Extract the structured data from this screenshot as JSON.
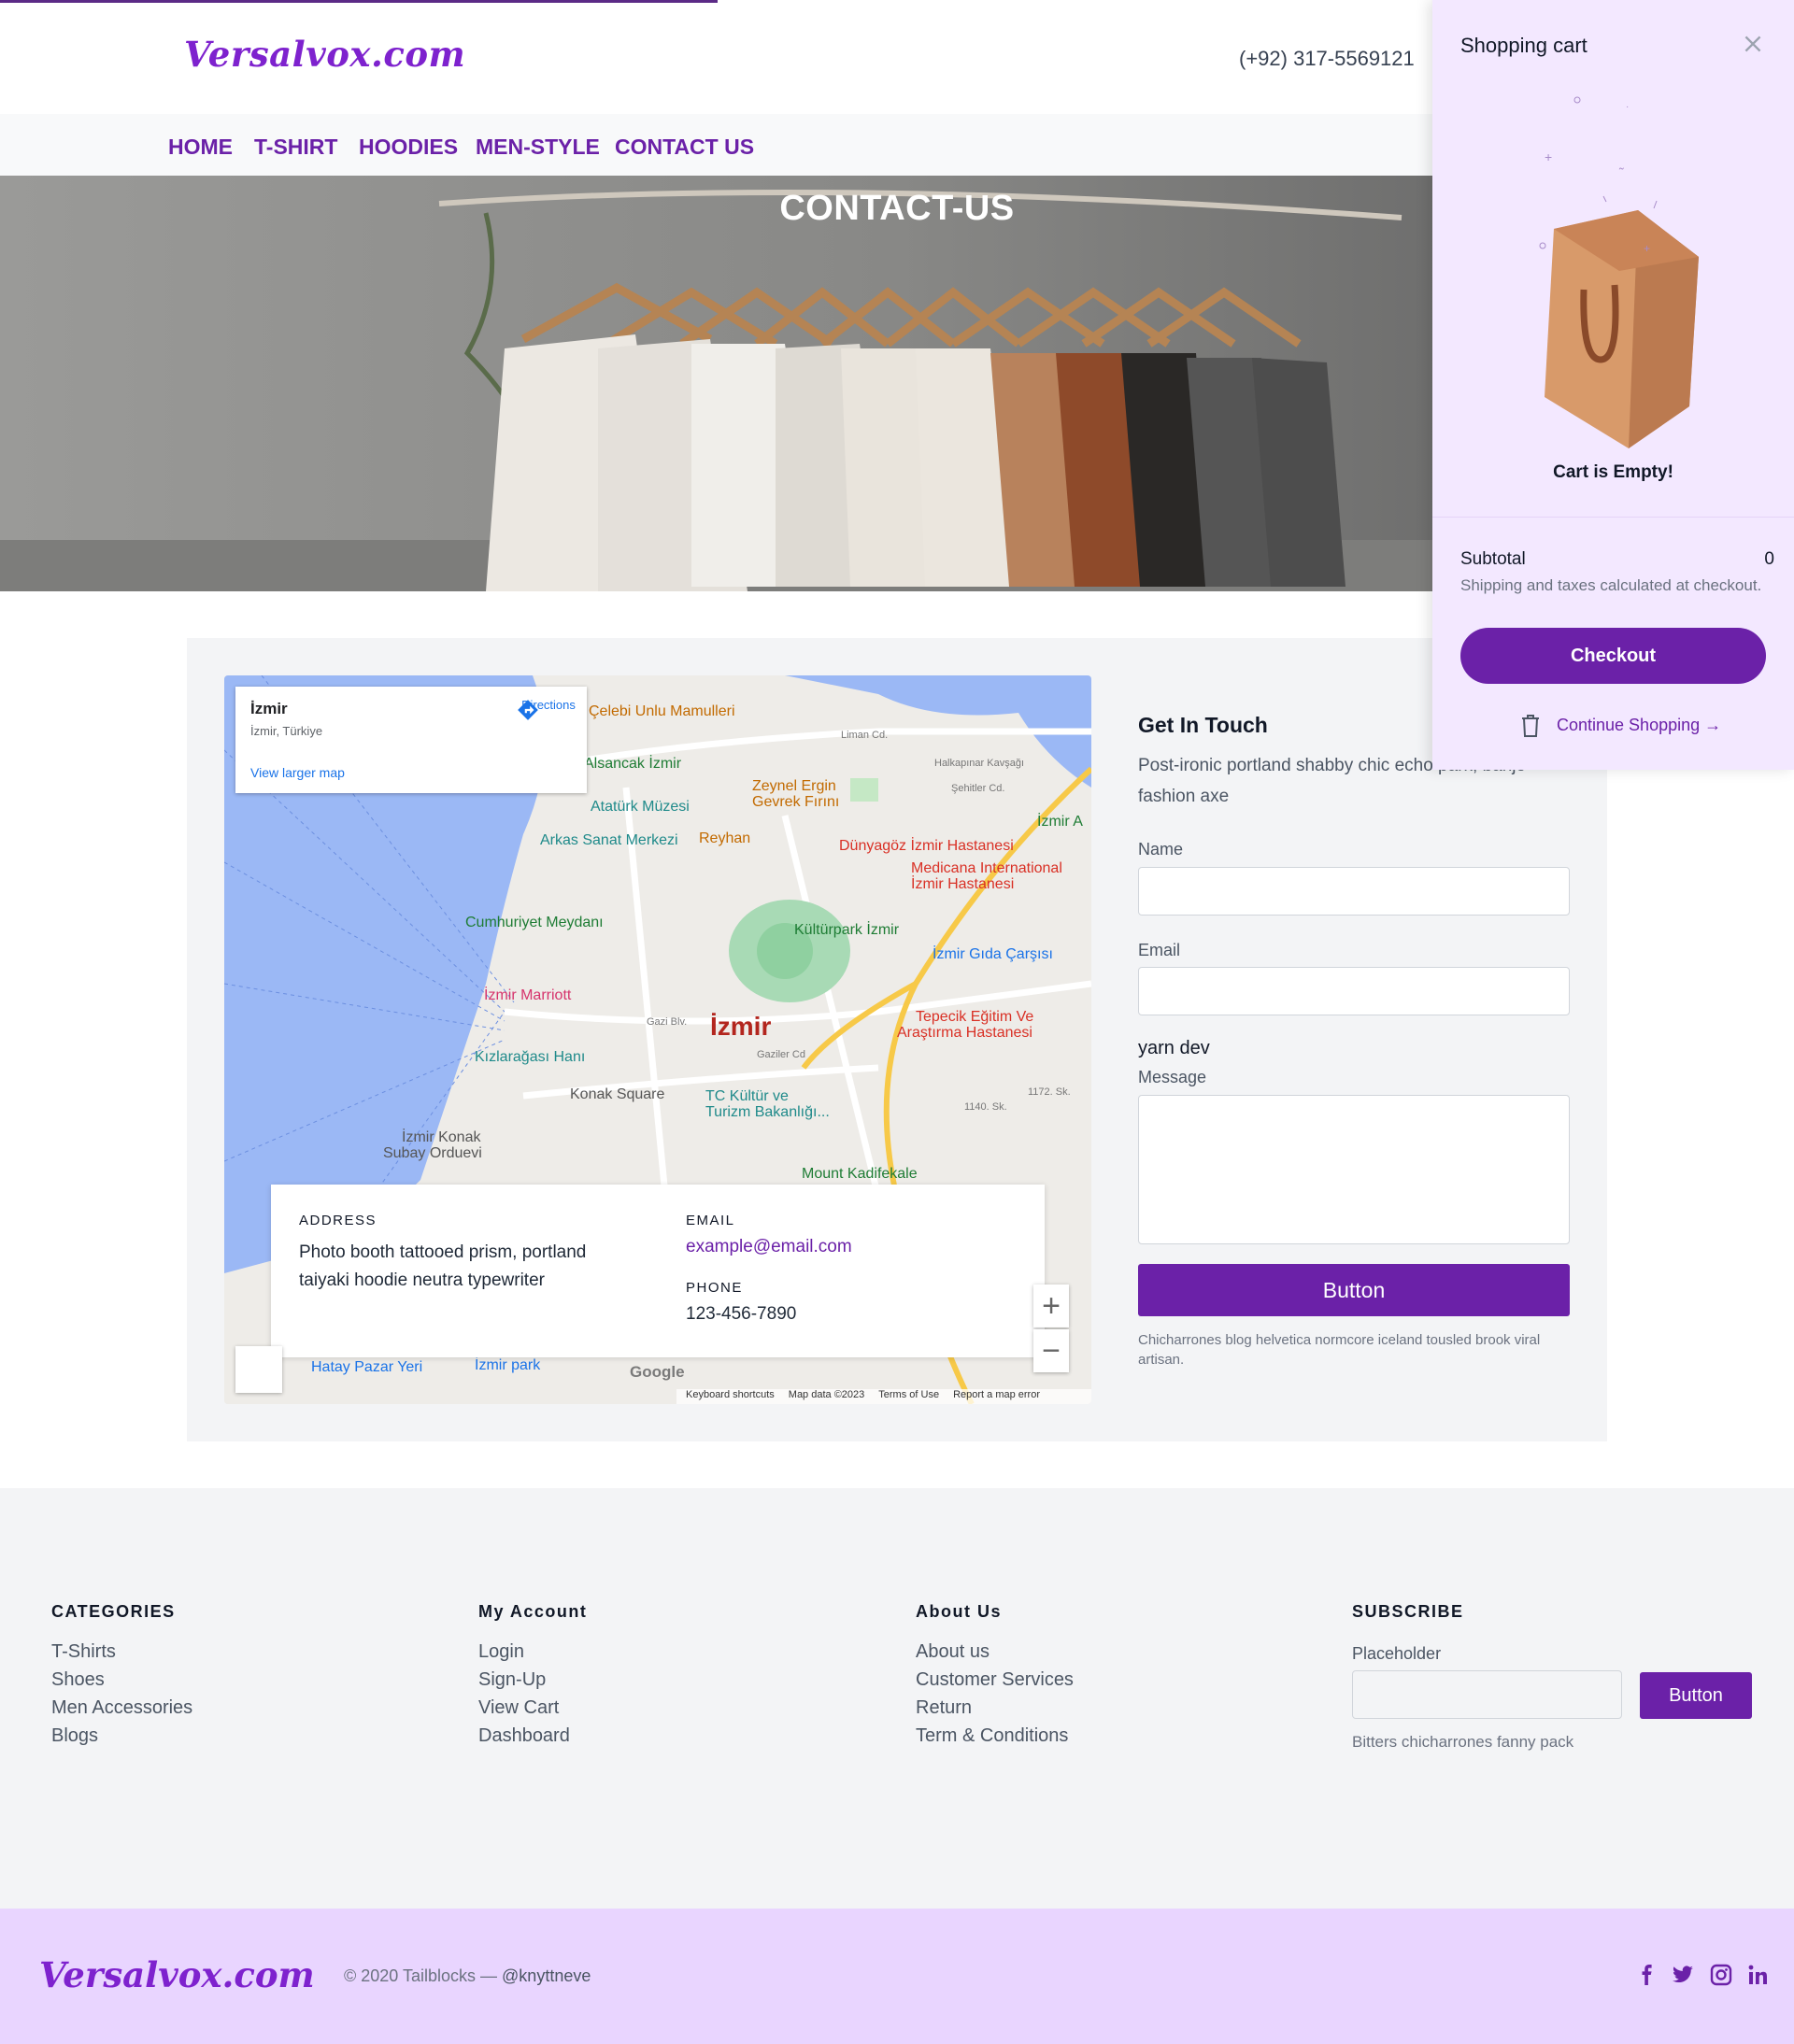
{
  "header": {
    "logo": "Versalvox.com",
    "phone": "(+92) 317-5569121"
  },
  "nav": [
    "HOME",
    "T-SHIRT",
    "HOODIES",
    "MEN-STYLE",
    "CONTACT US"
  ],
  "hero": {
    "title": "CONTACT-US"
  },
  "map": {
    "place_name": "İzmir",
    "place_sub": "İzmir, Türkiye",
    "directions": "Directions",
    "larger_map": "View larger map",
    "city_label": "İzmir",
    "labels": {
      "celebi": "Çelebi Unlu Mamulleri",
      "alsancak": "Alsancak İzmir",
      "ataturk": "Atatürk Müzesi",
      "zeynel": "Zeynel Ergin",
      "zeynel2": "Gevrek Fırını",
      "arkas": "Arkas Sanat Merkezi",
      "reyhan": "Reyhan",
      "dunya": "Dünyagöz İzmir Hastanesi",
      "medicana": "Medicana International",
      "medicana2": "İzmir Hastanesi",
      "cumhuriyet": "Cumhuriyet Meydanı",
      "kulturpark": "Kültürpark İzmir",
      "gida": "İzmir Gıda Çarşısı",
      "marriott": "İzmir Marriott",
      "tepecik": "Tepecik Eğitim Ve",
      "tepecik2": "Araştırma Hastanesi",
      "kizlaragasi": "Kızlarağası Hanı",
      "konak": "Konak Square",
      "tc": "TC Kültür ve",
      "tc2": "Turizm Bakanlığı...",
      "subay": "İzmir Konak",
      "subay2": "Subay Orduevi",
      "kadifekale": "Mount Kadifekale",
      "hatay": "Hatay Pazar Yeri",
      "izmirpark": "İzmir park",
      "liman": "Liman Cd.",
      "halkapinar": "Halkapınar Kavşağı",
      "sehitler": "Şehitler Cd.",
      "izmira": "İzmir A",
      "gazi": "Gazi Blv.",
      "gaziler": "Gaziler Cd",
      "s1140": "1140. Sk.",
      "s1172": "1172. Sk.",
      "google": "Google"
    },
    "footer_links": [
      "Keyboard shortcuts",
      "Map data ©2023",
      "Terms of Use",
      "Report a map error"
    ],
    "zoom_in": "+",
    "zoom_out": "−"
  },
  "info": {
    "address_label": "ADDRESS",
    "address": "Photo booth tattooed prism, portland taiyaki hoodie neutra typewriter",
    "email_label": "EMAIL",
    "email": "example@email.com",
    "phone_label": "PHONE",
    "phone": "123-456-7890"
  },
  "form": {
    "title": "Get In Touch",
    "subtitle": "Post-ironic portland shabby chic echo park, banjo fashion axe",
    "name_label": "Name",
    "email_label": "Email",
    "extra_text": "yarn dev",
    "message_label": "Message",
    "button": "Button",
    "note": "Chicharrones blog helvetica normcore iceland tousled brook viral artisan."
  },
  "footer": {
    "columns": [
      {
        "heading": "CATEGORIES",
        "links": [
          "T-Shirts",
          "Shoes",
          "Men Accessories",
          "Blogs"
        ]
      },
      {
        "heading": "My Account",
        "links": [
          "Login",
          "Sign-Up",
          "View Cart",
          "Dashboard"
        ]
      },
      {
        "heading": "About Us",
        "links": [
          "About us",
          "Customer Services",
          "Return",
          "Term & Conditions"
        ]
      }
    ],
    "subscribe": {
      "heading": "SUBSCRIBE",
      "label": "Placeholder",
      "button": "Button",
      "note": "Bitters chicharrones fanny pack"
    }
  },
  "bottom": {
    "logo": "Versalvox.com",
    "copyright": "© 2020 Tailblocks —",
    "handle": "@knyttneve",
    "social": [
      "facebook-icon",
      "twitter-icon",
      "instagram-icon",
      "linkedin-icon"
    ]
  },
  "cart": {
    "title": "Shopping cart",
    "empty": "Cart is Empty!",
    "subtotal_label": "Subtotal",
    "subtotal_value": "0",
    "shipping_note": "Shipping and taxes calculated at checkout.",
    "checkout": "Checkout",
    "continue": "Continue Shopping →"
  },
  "colors": {
    "brand": "#6b21a8",
    "logo": "#7e22ce",
    "cart_bg": "#f3e8ff",
    "bottom_bar": "#e9d5ff"
  }
}
